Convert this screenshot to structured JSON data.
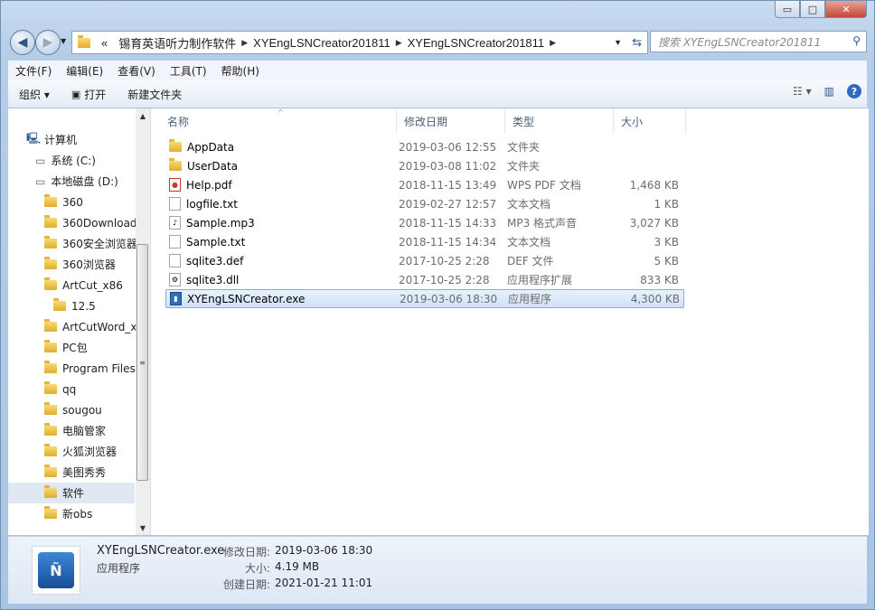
{
  "window": {
    "minimize": "▭",
    "maximize": "□",
    "close": "✕"
  },
  "nav": {
    "back": "◀",
    "forward": "▶"
  },
  "address": {
    "prefix": "«",
    "segments": [
      "锡育英语听力制作软件",
      "XYEngLSNCreator201811",
      "XYEngLSNCreator201811"
    ]
  },
  "search": {
    "placeholder": "搜索 XYEngLSNCreator201811"
  },
  "menu": [
    "文件(F)",
    "编辑(E)",
    "查看(V)",
    "工具(T)",
    "帮助(H)"
  ],
  "toolbar": {
    "organize": "组织 ▾",
    "open": "打开",
    "new_folder": "新建文件夹",
    "help": "?"
  },
  "tree": [
    {
      "label": "计算机",
      "indent": 20,
      "icon": "computer"
    },
    {
      "label": "系统 (C:)",
      "indent": 30,
      "icon": "drive"
    },
    {
      "label": "本地磁盘 (D:)",
      "indent": 30,
      "icon": "drive"
    },
    {
      "label": "360",
      "indent": 40,
      "icon": "folder"
    },
    {
      "label": "360Download",
      "indent": 40,
      "icon": "folder"
    },
    {
      "label": "360安全浏览器",
      "indent": 40,
      "icon": "folder"
    },
    {
      "label": "360浏览器",
      "indent": 40,
      "icon": "folder"
    },
    {
      "label": "ArtCut_x86",
      "indent": 40,
      "icon": "folder"
    },
    {
      "label": "12.5",
      "indent": 50,
      "icon": "folder"
    },
    {
      "label": "ArtCutWord_x",
      "indent": 40,
      "icon": "folder"
    },
    {
      "label": "PC包",
      "indent": 40,
      "icon": "folder"
    },
    {
      "label": "Program Files",
      "indent": 40,
      "icon": "folder"
    },
    {
      "label": "qq",
      "indent": 40,
      "icon": "folder"
    },
    {
      "label": "sougou",
      "indent": 40,
      "icon": "folder"
    },
    {
      "label": "电脑管家",
      "indent": 40,
      "icon": "folder"
    },
    {
      "label": "火狐浏览器",
      "indent": 40,
      "icon": "folder"
    },
    {
      "label": "美图秀秀",
      "indent": 40,
      "icon": "folder"
    },
    {
      "label": "软件",
      "indent": 40,
      "icon": "folder",
      "selected": true
    },
    {
      "label": "新obs",
      "indent": 40,
      "icon": "folder"
    }
  ],
  "columns": [
    "名称",
    "修改日期",
    "类型",
    "大小"
  ],
  "files": [
    {
      "name": "AppData",
      "date": "2019-03-06 12:55",
      "type": "文件夹",
      "size": "",
      "icon": "folder"
    },
    {
      "name": "UserData",
      "date": "2019-03-08 11:02",
      "type": "文件夹",
      "size": "",
      "icon": "folder"
    },
    {
      "name": "Help.pdf",
      "date": "2018-11-15 13:49",
      "type": "WPS PDF 文档",
      "size": "1,468 KB",
      "icon": "pdf"
    },
    {
      "name": "logfile.txt",
      "date": "2019-02-27 12:57",
      "type": "文本文档",
      "size": "1 KB",
      "icon": "txt"
    },
    {
      "name": "Sample.mp3",
      "date": "2018-11-15 14:33",
      "type": "MP3 格式声音",
      "size": "3,027 KB",
      "icon": "mp3"
    },
    {
      "name": "Sample.txt",
      "date": "2018-11-15 14:34",
      "type": "文本文档",
      "size": "3 KB",
      "icon": "txt"
    },
    {
      "name": "sqlite3.def",
      "date": "2017-10-25 2:28",
      "type": "DEF 文件",
      "size": "5 KB",
      "icon": "txt"
    },
    {
      "name": "sqlite3.dll",
      "date": "2017-10-25 2:28",
      "type": "应用程序扩展",
      "size": "833 KB",
      "icon": "dll"
    },
    {
      "name": "XYEngLSNCreator.exe",
      "date": "2019-03-06 18:30",
      "type": "应用程序",
      "size": "4,300 KB",
      "icon": "exe",
      "selected": true
    }
  ],
  "details": {
    "name": "XYEngLSNCreator.exe",
    "kind": "应用程序",
    "modified_label": "修改日期:",
    "modified": "2019-03-06 18:30",
    "size_label": "大小:",
    "size": "4.19 MB",
    "created_label": "创建日期:",
    "created": "2021-01-21 11:01"
  }
}
